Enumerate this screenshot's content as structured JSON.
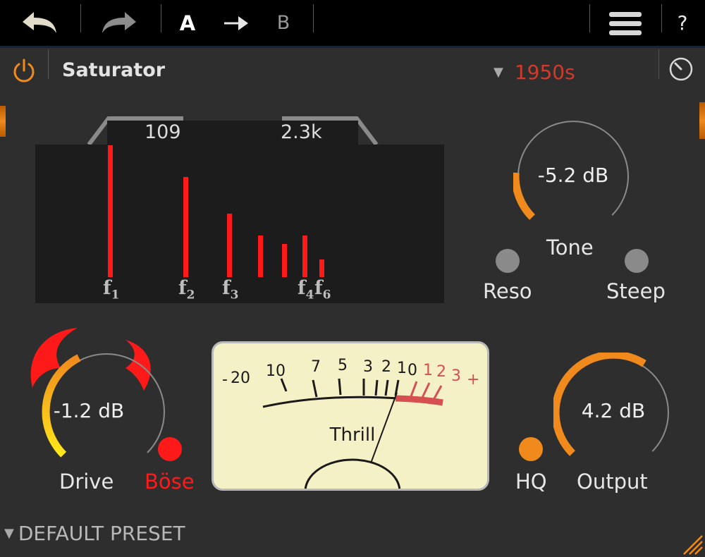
{
  "toolbar": {
    "undo_icon": "undo-arrow-icon",
    "redo_icon": "redo-arrow-icon",
    "ab_a": "A",
    "ab_arrow_icon": "arrow-right-icon",
    "ab_b": "B",
    "menu_icon": "hamburger-menu-icon",
    "help": "?"
  },
  "header": {
    "power_icon": "power-icon",
    "title": "Saturator",
    "mode_value": "1950s",
    "mode_arrow_icon": "dropdown-triangle-icon",
    "meter_icon": "dial-icon"
  },
  "spectrum": {
    "low_freq": "109",
    "high_freq": "2.3k",
    "harmonics": [
      {
        "label": "f",
        "sub": "1",
        "level": 0.83
      },
      {
        "label": "f",
        "sub": "2",
        "level": 0.63
      },
      {
        "label": "f",
        "sub": "3",
        "level": 0.4
      },
      {
        "label": "",
        "sub": "",
        "level": 0.26
      },
      {
        "label": "",
        "sub": "",
        "level": 0.21
      },
      {
        "label": "f",
        "sub": "4",
        "level": 0.26
      },
      {
        "label": "f",
        "sub": "6",
        "level": 0.11
      }
    ]
  },
  "tone": {
    "value": "-5.2 dB",
    "label": "Tone",
    "level": 0.18
  },
  "reso": {
    "label": "Reso"
  },
  "steep": {
    "label": "Steep"
  },
  "drive": {
    "value": "-1.2 dB",
    "label": "Drive",
    "level": 0.4
  },
  "bose": {
    "label": "Böse"
  },
  "vu": {
    "label": "Thrill",
    "scale_black": [
      "-",
      "20",
      "10",
      "7",
      "5",
      "3",
      "2",
      "1",
      "0"
    ],
    "scale_red": [
      "1",
      "2",
      "3",
      "+"
    ]
  },
  "hq": {
    "label": "HQ"
  },
  "output": {
    "value": "4.2 dB",
    "label": "Output",
    "level": 0.62
  },
  "footer": {
    "preset": "DEFAULT PRESET"
  },
  "colors": {
    "accent": "#f08a1c",
    "red": "#ff1a1a",
    "mode_red": "#d23a2a",
    "vu_face": "#f5f1c6"
  }
}
